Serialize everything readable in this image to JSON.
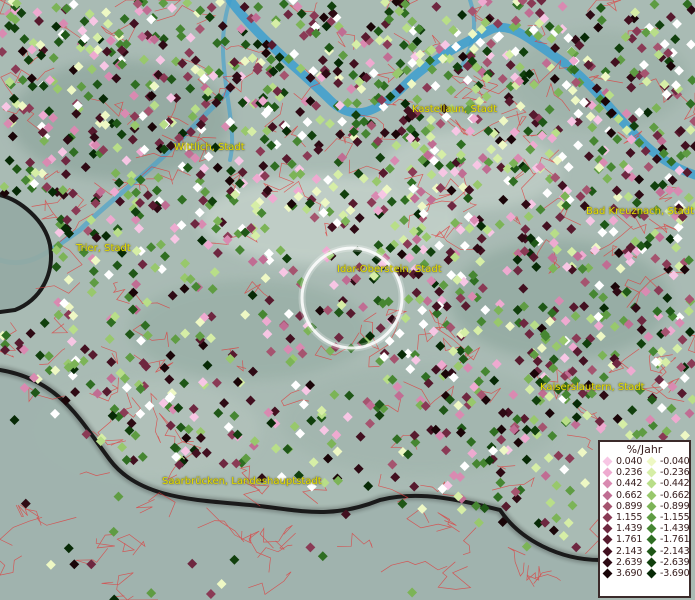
{
  "map": {
    "focus_circle": {
      "visible": true
    }
  },
  "city_labels": [
    "Kastellaun, Stadt",
    "Wittlich, Stadt",
    "Bad Kreuznach, Stadt",
    "Trier, Stadt",
    "Idar-Oberstein, Stadt",
    "Kaiserslautern, Stadt",
    "Saarbrücken, Landeshauptstadt"
  ],
  "legend": {
    "title": "%/Jahr",
    "positive": [
      {
        "value": "0.040",
        "color": "#f7c6e4"
      },
      {
        "value": "0.236",
        "color": "#eeaad0"
      },
      {
        "value": "0.442",
        "color": "#d98ab1"
      },
      {
        "value": "0.662",
        "color": "#c06d93"
      },
      {
        "value": "0.899",
        "color": "#a5546f"
      },
      {
        "value": "1.155",
        "color": "#8a3a55"
      },
      {
        "value": "1.439",
        "color": "#6e2740"
      },
      {
        "value": "1.761",
        "color": "#571a2e"
      },
      {
        "value": "2.143",
        "color": "#421020"
      },
      {
        "value": "2.639",
        "color": "#2e0a14"
      },
      {
        "value": "3.690",
        "color": "#1a0508"
      }
    ],
    "negative": [
      {
        "value": "-0.040",
        "color": "#eef8c4"
      },
      {
        "value": "-0.236",
        "color": "#d6eea6"
      },
      {
        "value": "-0.442",
        "color": "#b8de88"
      },
      {
        "value": "-0.662",
        "color": "#98c86c"
      },
      {
        "value": "-0.899",
        "color": "#7cb457"
      },
      {
        "value": "-1.155",
        "color": "#5f9c43"
      },
      {
        "value": "-1.439",
        "color": "#468632"
      },
      {
        "value": "-1.761",
        "color": "#2f6e22"
      },
      {
        "value": "-2.143",
        "color": "#1f5717"
      },
      {
        "value": "-2.639",
        "color": "#11400d"
      },
      {
        "value": "-3.690",
        "color": "#072a06"
      }
    ]
  }
}
